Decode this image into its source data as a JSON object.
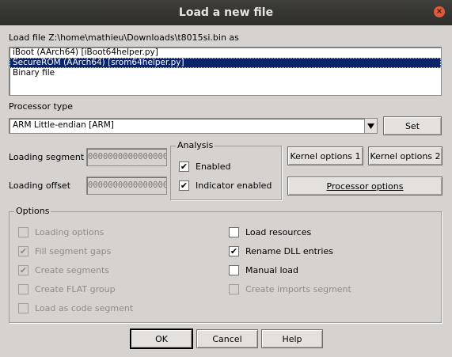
{
  "window": {
    "title": "Load a new file",
    "close_glyph": "×"
  },
  "load_file_label": "Load file Z:\\home\\mathieu\\Downloads\\t8015si.bin as",
  "file_types": [
    {
      "label": "iBoot (AArch64) [iBoot64helper.py]",
      "selected": false
    },
    {
      "label": "SecureROM (AArch64) [srom64helper.py]",
      "selected": true
    },
    {
      "label": "Binary file",
      "selected": false
    }
  ],
  "processor": {
    "label": "Processor type",
    "value": "ARM Little-endian [ARM]",
    "set_button": "Set"
  },
  "loading": {
    "segment_label": "Loading segment",
    "segment_value": "0000000000000000",
    "offset_label": "Loading offset",
    "offset_value": "0000000000000000"
  },
  "analysis": {
    "title": "Analysis",
    "enabled_label": "Enabled",
    "enabled_checked": true,
    "indicator_label": "Indicator enabled",
    "indicator_checked": true
  },
  "buttons": {
    "kernel1": "Kernel options 1",
    "kernel2": "Kernel options 2",
    "processor_options": "Processor options",
    "ok": "OK",
    "cancel": "Cancel",
    "help": "Help"
  },
  "options": {
    "title": "Options",
    "left": [
      {
        "label": "Loading options",
        "checked": false,
        "disabled": true
      },
      {
        "label": "Fill segment gaps",
        "checked": true,
        "disabled": true
      },
      {
        "label": "Create segments",
        "checked": true,
        "disabled": true
      },
      {
        "label": "Create FLAT group",
        "checked": false,
        "disabled": true
      },
      {
        "label": "Load as code segment",
        "checked": false,
        "disabled": true
      }
    ],
    "right": [
      {
        "label": "Load resources",
        "checked": false,
        "disabled": false
      },
      {
        "label": "Rename DLL entries",
        "checked": true,
        "disabled": false
      },
      {
        "label": "Manual load",
        "checked": false,
        "disabled": false
      },
      {
        "label": "Create imports segment",
        "checked": false,
        "disabled": true
      }
    ]
  },
  "colors": {
    "titlebar": "#2f2e2a",
    "dialog_bg": "#d6d2d0",
    "selection": "#0a236b",
    "close": "#e25a3a"
  },
  "icons": {
    "close": "close-icon",
    "dropdown": "chevron-down-icon",
    "check": "check-icon"
  }
}
